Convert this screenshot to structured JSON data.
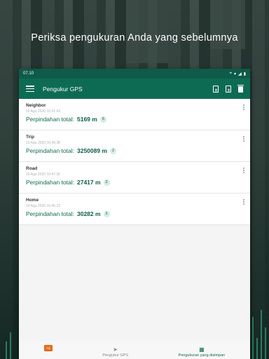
{
  "headline": "Periksa pengukuran Anda yang sebelumnya",
  "status_bar": {
    "time": "07.10"
  },
  "app_bar": {
    "title": "Pengukur GPS"
  },
  "measurements": [
    {
      "name": "Neighbor",
      "date": "19 Agu 2020 10.51.43",
      "label": "Perpindahan total:",
      "value": "5169 m",
      "count": "6"
    },
    {
      "name": "Trip",
      "date": "19 Agu 2020 10.49.38",
      "label": "Perpindahan total:",
      "value": "3250089 m",
      "count": "2"
    },
    {
      "name": "Road",
      "date": "19 Agu 2020 10.47.36",
      "label": "Perpindahan total:",
      "value": "27417 m",
      "count": "2"
    },
    {
      "name": "Home",
      "date": "19 Agu 2020 10.46.23",
      "label": "Perpindahan total:",
      "value": "30282 m",
      "count": "2"
    }
  ],
  "bottom_nav": {
    "ad_label": "Ad",
    "tab_measure": "Pengukur GPS",
    "tab_saved": "Pengukuran yang disimpan"
  },
  "colors": {
    "primary": "#0e6b53",
    "status_bar": "#0e5b49",
    "ad_accent": "#e86a1a"
  },
  "icons": [
    "menu-icon",
    "document-icon",
    "document-export-icon",
    "trash-icon",
    "more-vert-icon",
    "navigation-arrow-icon",
    "calendar-icon"
  ]
}
